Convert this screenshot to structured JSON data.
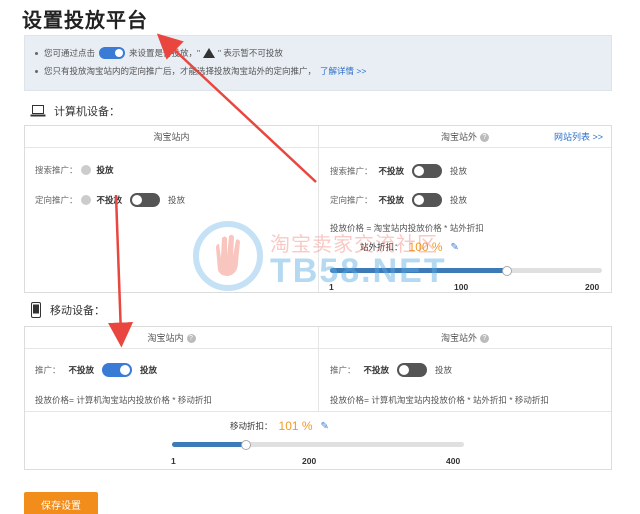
{
  "page": {
    "title": "设置投放平台"
  },
  "notice": {
    "line1_pre": "您可通过点击",
    "line1_mid": "来设置是否投放，\"",
    "line1_post": "\" 表示暂不可投放",
    "line2": "您只有投放淘宝站内的定向推广后，才能选择投放淘宝站外的定向推广，",
    "line2_link": "了解详情 >>"
  },
  "computer": {
    "heading": "计算机设备：",
    "inside_title": "淘宝站内",
    "outside_title": "淘宝站外",
    "outside_link": "网站列表 >>",
    "inside_rows": [
      {
        "label": "搜索推广：",
        "off": "",
        "on": "投放"
      },
      {
        "label": "定向推广：",
        "off": "不投放",
        "on": "投放"
      }
    ],
    "outside_rows": [
      {
        "label": "搜索推广：",
        "off": "不投放",
        "on": "投放"
      },
      {
        "label": "定向推广：",
        "off": "不投放",
        "on": "投放"
      }
    ],
    "price_formula": "投放价格 = 淘宝站内投放价格 * 站外折扣",
    "discount_label": "站外折扣：",
    "discount_value": "100 %",
    "slider": {
      "min": "1",
      "mid": "100",
      "max": "200",
      "value": 100,
      "range_max": 200
    }
  },
  "mobile": {
    "heading": "移动设备：",
    "inside_title": "淘宝站内",
    "outside_title": "淘宝站外",
    "inside_row": {
      "label": "推广：",
      "off": "不投放",
      "on": "投放"
    },
    "outside_row": {
      "label": "推广：",
      "off": "不投放",
      "on": "投放"
    },
    "inside_formula": "投放价格= 计算机淘宝站内投放价格 * 移动折扣",
    "outside_formula": "投放价格= 计算机淘宝站内投放价格 * 站外折扣 * 移动折扣",
    "discount_label": "移动折扣：",
    "discount_value": "101 %",
    "slider": {
      "min": "1",
      "mid": "200",
      "max": "400",
      "value": 101,
      "range_max": 400
    }
  },
  "save_button": "保存设置",
  "watermark": {
    "line1": "淘宝卖家交流社区",
    "line2": "TB58.NET"
  },
  "colors": {
    "accent": "#3a7bd5",
    "orange": "#f28c1a",
    "arrow": "#e8463e"
  },
  "icons": {
    "computer": "laptop-icon",
    "mobile": "phone-icon",
    "help": "question-icon",
    "edit": "pencil-icon"
  }
}
